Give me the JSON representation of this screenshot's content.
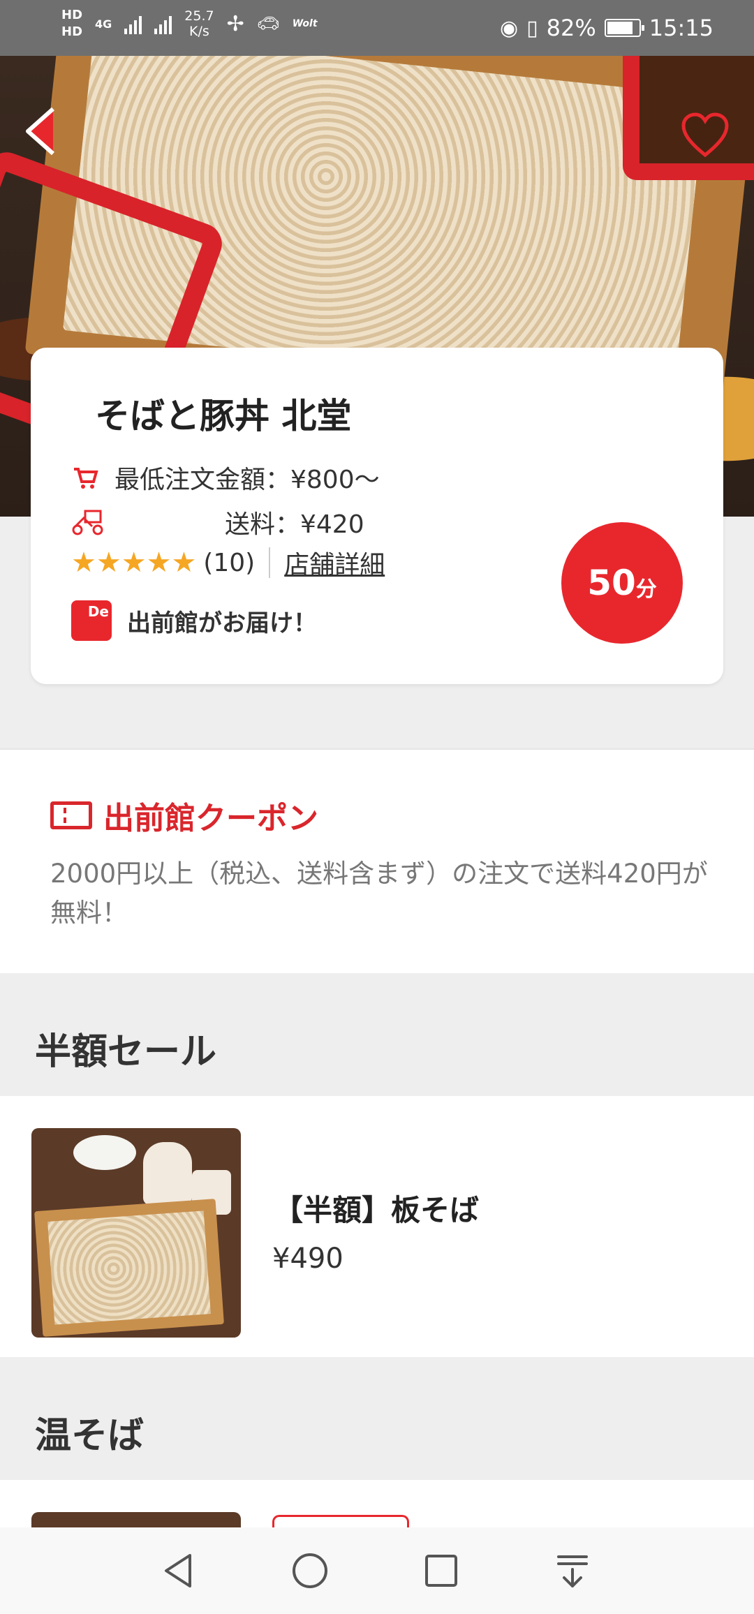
{
  "status_bar": {
    "hd1": "HD",
    "hd2": "HD",
    "net1": "4G",
    "speed_value": "25.7",
    "speed_unit": "K/s",
    "wolt": "Wolt",
    "battery": "82%",
    "battery_level": 0.82,
    "time": "15:15"
  },
  "store": {
    "name": "そばと豚丼 北堂",
    "min_order": "最低注文金額：¥800〜",
    "delivery_fee": "送料：¥420",
    "rating_stars": 5,
    "rating_count": "(10)",
    "detail_link": "店舗詳細",
    "delivered_by": "出前館がお届け！",
    "logo_text": "De",
    "time_value": "50",
    "time_unit": "分"
  },
  "coupon": {
    "title": "出前館クーポン",
    "text": "2000円以上（税込、送料含まず）の注文で送料420円が無料！"
  },
  "sections": {
    "sale": {
      "title": "半額セール",
      "items": [
        {
          "name": "【半額】板そば",
          "price": "¥490"
        }
      ]
    },
    "onsoba": {
      "title": "温そば"
    }
  },
  "colors": {
    "accent": "#e8272d",
    "star": "#f5a623",
    "section_bg": "#eeeeee"
  },
  "icons": {
    "back": "back-arrow-icon",
    "favorite": "heart-icon",
    "cart": "cart-icon",
    "delivery": "delivery-bike-icon",
    "coupon": "ticket-icon"
  }
}
